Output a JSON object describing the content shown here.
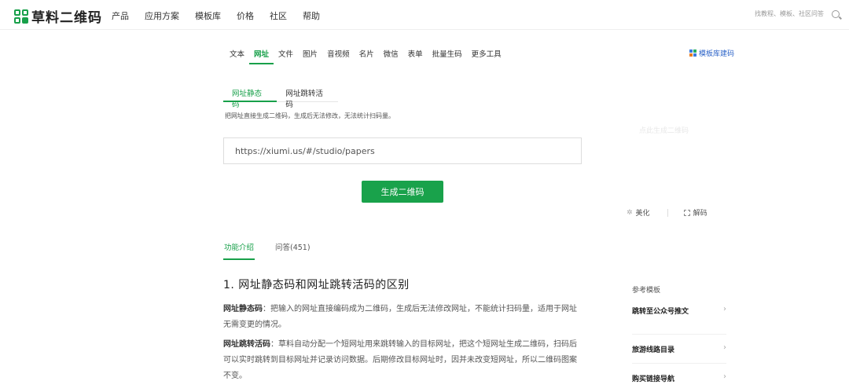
{
  "header": {
    "logo": "草料二维码",
    "nav": [
      "产品",
      "应用方案",
      "模板库",
      "价格",
      "社区",
      "帮助"
    ],
    "search_placeholder": "找教程、模板、社区问答"
  },
  "categories": {
    "items": [
      "文本",
      "网址",
      "文件",
      "图片",
      "音视频",
      "名片",
      "微信",
      "表单",
      "批量生码",
      "更多工具"
    ],
    "active": "网址",
    "template_build": "模板库建码"
  },
  "subtabs": {
    "items": [
      "网址静态码",
      "网址跳转活码"
    ],
    "active": "网址静态码"
  },
  "description": "把网址直接生成二维码，生成后无法修改，无法统计扫码量。",
  "right_hint": "点此生成二维码",
  "url_input": {
    "value": "https://xiumi.us/#/studio/papers",
    "placeholder": ""
  },
  "generate_button": "生成二维码",
  "tools": {
    "beautify": "美化",
    "decode": "解码"
  },
  "content_tabs": {
    "items": [
      "功能介绍",
      "问答(451)"
    ],
    "active": "功能介绍"
  },
  "article": {
    "heading": "1. 网址静态码和网址跳转活码的区别",
    "para1_term": "网址静态码",
    "para1_text": "：把输入的网址直接编码成为二维码，生成后无法修改网址，不能统计扫码量，适用于网址无需变更的情况。",
    "para2_term": "网址跳转活码",
    "para2_text": "：草料自动分配一个短网址用来跳转输入的目标网址，把这个短网址生成二维码，扫码后可以实时跳转到目标网址并记录访问数据。后期修改目标网址时，因并未改变短网址，所以二维码图案不变。"
  },
  "reference": {
    "title": "参考模板",
    "items": [
      "跳转至公众号推文",
      "旅游线路目录",
      "购买链接导航"
    ]
  },
  "colors": {
    "brand_green": "#19a24b",
    "link_blue": "#2d64c8"
  },
  "icons": [
    "search-icon",
    "grid-icon",
    "sparkle-icon",
    "scan-icon",
    "chevron-right-icon"
  ]
}
